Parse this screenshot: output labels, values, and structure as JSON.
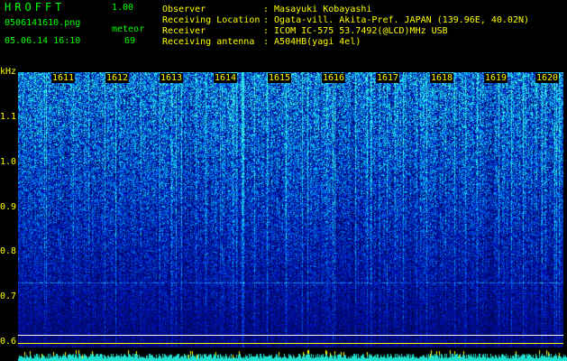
{
  "header": {
    "app_title": "HROFFT",
    "version": "1.00",
    "filename": "0506141610.png",
    "mode": "meteor",
    "timestamp": "05.06.14 16:10",
    "count": "69"
  },
  "info": [
    {
      "label": "Observer",
      "value": ": Masayuki Kobayashi"
    },
    {
      "label": "Receiving Location",
      "value": ": Ogata-vill. Akita-Pref. JAPAN (139.96E, 40.02N)"
    },
    {
      "label": "Receiver",
      "value": ": ICOM IC-575 53.7492(@LCD)MHz USB"
    },
    {
      "label": "Receiving antenna",
      "value": ": A504HB(yagi 4el)"
    }
  ],
  "axis": {
    "unit": "kHz",
    "y_ticks": [
      "1.1",
      "1.0",
      "0.9",
      "0.8",
      "0.7",
      "0.6"
    ],
    "time_ticks": [
      "1611",
      "1612",
      "1613",
      "1614",
      "1615",
      "1616",
      "1617",
      "1618",
      "1619",
      "1620"
    ]
  },
  "colors": {
    "text_primary": "#ffff00",
    "text_secondary": "#00ff00",
    "background": "#000000",
    "noise_low": "#001a66",
    "noise_high": "#00ffcc"
  }
}
